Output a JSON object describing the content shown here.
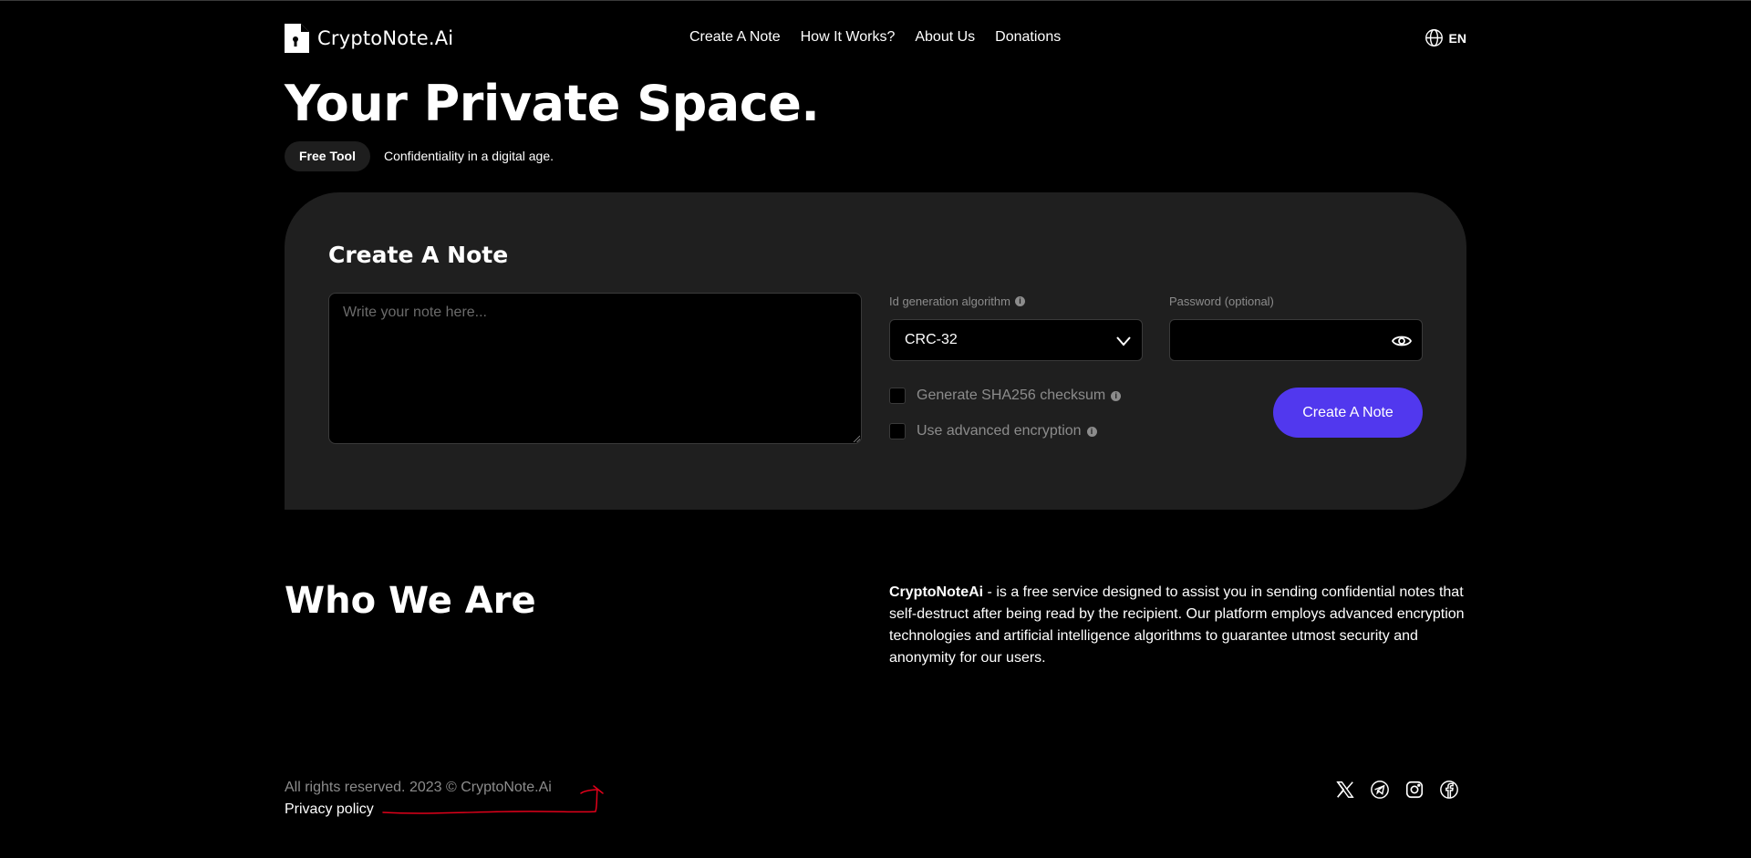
{
  "header": {
    "brand": "CryptoNote.Ai",
    "nav": [
      "Create A Note",
      "How It Works?",
      "About Us",
      "Donations"
    ],
    "language": "EN"
  },
  "hero": {
    "title": "Your Private Space.",
    "badge": "Free Tool",
    "tagline": "Confidentiality in a digital age."
  },
  "note_form": {
    "title": "Create A Note",
    "note_placeholder": "Write your note here...",
    "algorithm_label": "Id generation algorithm",
    "algorithm_value": "CRC-32",
    "password_label": "Password (optional)",
    "checksum_label": "Generate SHA256 checksum",
    "encryption_label": "Use advanced encryption",
    "submit_label": "Create A Note"
  },
  "about": {
    "title": "Who We Are",
    "brand": "CryptoNoteAi",
    "text": " - is a free service designed to assist you in sending confidential notes that self-destruct after being read by the recipient. Our platform employs advanced encryption technologies and artificial intelligence algorithms to guarantee utmost security and anonymity for our users."
  },
  "footer": {
    "copyright": "All rights reserved. 2023 © CryptoNote.Ai",
    "privacy": "Privacy policy",
    "socials": [
      "x-icon",
      "telegram-icon",
      "instagram-icon",
      "facebook-icon"
    ]
  },
  "colors": {
    "background": "#000000",
    "card": "#1f1f1f",
    "accent": "#5138ee",
    "muted_text": "#8c8c8c",
    "annotation": "#e0001a"
  }
}
